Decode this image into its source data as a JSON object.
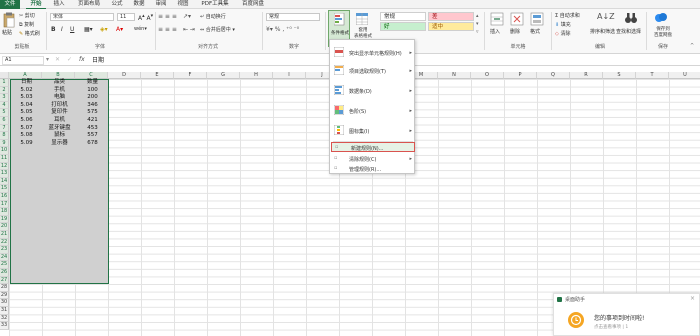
{
  "tabs": [
    "文件",
    "开始",
    "插入",
    "页面布局",
    "公式",
    "数据",
    "审阅",
    "视图",
    "PDF工具集",
    "百度网盘"
  ],
  "ribbon": {
    "clipboard": {
      "paste": "粘贴",
      "cut": "剪切",
      "copy": "复制",
      "format_painter": "格式刷",
      "label": "剪贴板"
    },
    "font": {
      "name": "宋体",
      "size": "11",
      "label": "字体"
    },
    "alignment": {
      "wrap": "自动换行",
      "merge": "合并后居中",
      "label": "对齐方式"
    },
    "number": {
      "format": "常规",
      "label": "数字"
    },
    "styles": {
      "conditional": "条件格式",
      "table_format": "套用\n表格格式",
      "normal": "常规",
      "bad": "差",
      "good": "好",
      "neutral": "适中"
    },
    "cells": {
      "insert": "插入",
      "delete": "删除",
      "format": "格式",
      "label": "单元格"
    },
    "editing": {
      "autosum": "自动求和",
      "fill": "填充",
      "clear": "清除",
      "sort": "排序和筛选",
      "find": "查找和选择",
      "label": "编辑"
    },
    "save": {
      "btn": "保存到\n百度网盘",
      "label": "保存"
    }
  },
  "formula_bar": {
    "name_box": "A1",
    "content": "日期"
  },
  "columns": [
    "A",
    "B",
    "C",
    "D",
    "E",
    "F",
    "G",
    "H",
    "I",
    "J",
    "K",
    "L",
    "M",
    "N",
    "O",
    "P",
    "Q",
    "R",
    "S",
    "T",
    "U"
  ],
  "rows": [
    "1",
    "2",
    "3",
    "4",
    "5",
    "6",
    "7",
    "8",
    "9",
    "10",
    "11",
    "12",
    "13",
    "14",
    "15",
    "16",
    "17",
    "18",
    "19",
    "20",
    "21",
    "22",
    "23",
    "24",
    "25",
    "26",
    "27",
    "28",
    "29",
    "30",
    "31",
    "32",
    "33"
  ],
  "table": {
    "headers": [
      "日期",
      "品类",
      "数量"
    ],
    "rows": [
      [
        "5.02",
        "手机",
        "100"
      ],
      [
        "5.03",
        "电脑",
        "200"
      ],
      [
        "5.04",
        "打印机",
        "346"
      ],
      [
        "5.05",
        "复印件",
        "575"
      ],
      [
        "5.06",
        "耳机",
        "421"
      ],
      [
        "5.07",
        "蓝牙键盘",
        "453"
      ],
      [
        "5.08",
        "鼠标",
        "557"
      ],
      [
        "5.09",
        "显示器",
        "678"
      ]
    ]
  },
  "menu": {
    "items": [
      {
        "label": "突出显示单元格规则(H)",
        "icon": "highlight-rules-icon",
        "arrow": "▸"
      },
      {
        "label": "项目选取规则(T)",
        "icon": "top-bottom-rules-icon",
        "arrow": "▸"
      },
      {
        "label": "数据条(D)",
        "icon": "data-bars-icon",
        "arrow": "▸"
      },
      {
        "label": "色阶(S)",
        "icon": "color-scales-icon",
        "arrow": "▸"
      },
      {
        "label": "图标集(I)",
        "icon": "icon-sets-icon",
        "arrow": "▸"
      }
    ],
    "new_rule": "新建规则(N)...",
    "clear_rules": "清除规则(C)",
    "manage_rules": "管理规则(R)..."
  },
  "notification": {
    "title": "桌面助手",
    "message": "您的事项到时间啦!",
    "sub": "点击查看事项 | 1"
  },
  "colors": {
    "excel_green": "#217346",
    "selection": "#d0d0d0",
    "highlight_border": "#d9534f",
    "bad_bg": "#ffc7ce",
    "good_bg": "#c6efce",
    "neutral_bg": "#ffeb9c",
    "notice_orange": "#f5a623"
  }
}
